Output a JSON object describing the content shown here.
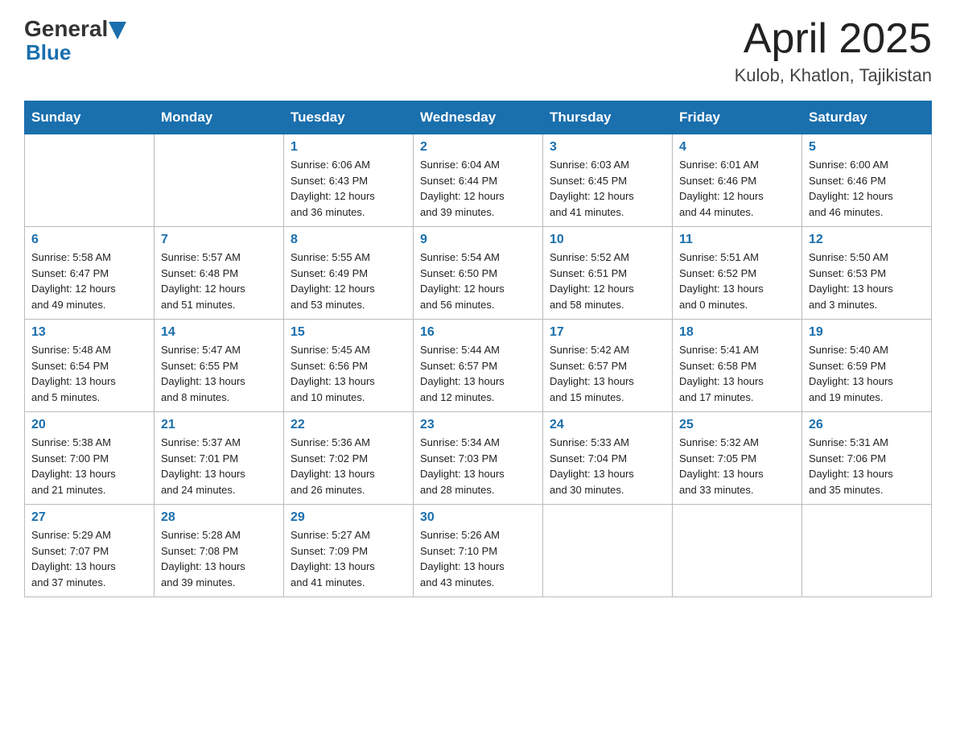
{
  "header": {
    "logo_general": "General",
    "logo_blue": "Blue",
    "title": "April 2025",
    "location": "Kulob, Khatlon, Tajikistan"
  },
  "days_of_week": [
    "Sunday",
    "Monday",
    "Tuesday",
    "Wednesday",
    "Thursday",
    "Friday",
    "Saturday"
  ],
  "weeks": [
    [
      {
        "day": "",
        "info": ""
      },
      {
        "day": "",
        "info": ""
      },
      {
        "day": "1",
        "info": "Sunrise: 6:06 AM\nSunset: 6:43 PM\nDaylight: 12 hours\nand 36 minutes."
      },
      {
        "day": "2",
        "info": "Sunrise: 6:04 AM\nSunset: 6:44 PM\nDaylight: 12 hours\nand 39 minutes."
      },
      {
        "day": "3",
        "info": "Sunrise: 6:03 AM\nSunset: 6:45 PM\nDaylight: 12 hours\nand 41 minutes."
      },
      {
        "day": "4",
        "info": "Sunrise: 6:01 AM\nSunset: 6:46 PM\nDaylight: 12 hours\nand 44 minutes."
      },
      {
        "day": "5",
        "info": "Sunrise: 6:00 AM\nSunset: 6:46 PM\nDaylight: 12 hours\nand 46 minutes."
      }
    ],
    [
      {
        "day": "6",
        "info": "Sunrise: 5:58 AM\nSunset: 6:47 PM\nDaylight: 12 hours\nand 49 minutes."
      },
      {
        "day": "7",
        "info": "Sunrise: 5:57 AM\nSunset: 6:48 PM\nDaylight: 12 hours\nand 51 minutes."
      },
      {
        "day": "8",
        "info": "Sunrise: 5:55 AM\nSunset: 6:49 PM\nDaylight: 12 hours\nand 53 minutes."
      },
      {
        "day": "9",
        "info": "Sunrise: 5:54 AM\nSunset: 6:50 PM\nDaylight: 12 hours\nand 56 minutes."
      },
      {
        "day": "10",
        "info": "Sunrise: 5:52 AM\nSunset: 6:51 PM\nDaylight: 12 hours\nand 58 minutes."
      },
      {
        "day": "11",
        "info": "Sunrise: 5:51 AM\nSunset: 6:52 PM\nDaylight: 13 hours\nand 0 minutes."
      },
      {
        "day": "12",
        "info": "Sunrise: 5:50 AM\nSunset: 6:53 PM\nDaylight: 13 hours\nand 3 minutes."
      }
    ],
    [
      {
        "day": "13",
        "info": "Sunrise: 5:48 AM\nSunset: 6:54 PM\nDaylight: 13 hours\nand 5 minutes."
      },
      {
        "day": "14",
        "info": "Sunrise: 5:47 AM\nSunset: 6:55 PM\nDaylight: 13 hours\nand 8 minutes."
      },
      {
        "day": "15",
        "info": "Sunrise: 5:45 AM\nSunset: 6:56 PM\nDaylight: 13 hours\nand 10 minutes."
      },
      {
        "day": "16",
        "info": "Sunrise: 5:44 AM\nSunset: 6:57 PM\nDaylight: 13 hours\nand 12 minutes."
      },
      {
        "day": "17",
        "info": "Sunrise: 5:42 AM\nSunset: 6:57 PM\nDaylight: 13 hours\nand 15 minutes."
      },
      {
        "day": "18",
        "info": "Sunrise: 5:41 AM\nSunset: 6:58 PM\nDaylight: 13 hours\nand 17 minutes."
      },
      {
        "day": "19",
        "info": "Sunrise: 5:40 AM\nSunset: 6:59 PM\nDaylight: 13 hours\nand 19 minutes."
      }
    ],
    [
      {
        "day": "20",
        "info": "Sunrise: 5:38 AM\nSunset: 7:00 PM\nDaylight: 13 hours\nand 21 minutes."
      },
      {
        "day": "21",
        "info": "Sunrise: 5:37 AM\nSunset: 7:01 PM\nDaylight: 13 hours\nand 24 minutes."
      },
      {
        "day": "22",
        "info": "Sunrise: 5:36 AM\nSunset: 7:02 PM\nDaylight: 13 hours\nand 26 minutes."
      },
      {
        "day": "23",
        "info": "Sunrise: 5:34 AM\nSunset: 7:03 PM\nDaylight: 13 hours\nand 28 minutes."
      },
      {
        "day": "24",
        "info": "Sunrise: 5:33 AM\nSunset: 7:04 PM\nDaylight: 13 hours\nand 30 minutes."
      },
      {
        "day": "25",
        "info": "Sunrise: 5:32 AM\nSunset: 7:05 PM\nDaylight: 13 hours\nand 33 minutes."
      },
      {
        "day": "26",
        "info": "Sunrise: 5:31 AM\nSunset: 7:06 PM\nDaylight: 13 hours\nand 35 minutes."
      }
    ],
    [
      {
        "day": "27",
        "info": "Sunrise: 5:29 AM\nSunset: 7:07 PM\nDaylight: 13 hours\nand 37 minutes."
      },
      {
        "day": "28",
        "info": "Sunrise: 5:28 AM\nSunset: 7:08 PM\nDaylight: 13 hours\nand 39 minutes."
      },
      {
        "day": "29",
        "info": "Sunrise: 5:27 AM\nSunset: 7:09 PM\nDaylight: 13 hours\nand 41 minutes."
      },
      {
        "day": "30",
        "info": "Sunrise: 5:26 AM\nSunset: 7:10 PM\nDaylight: 13 hours\nand 43 minutes."
      },
      {
        "day": "",
        "info": ""
      },
      {
        "day": "",
        "info": ""
      },
      {
        "day": "",
        "info": ""
      }
    ]
  ],
  "colors": {
    "header_bg": "#1a6fad",
    "accent": "#1a6fad",
    "day_number": "#1a6fad"
  }
}
